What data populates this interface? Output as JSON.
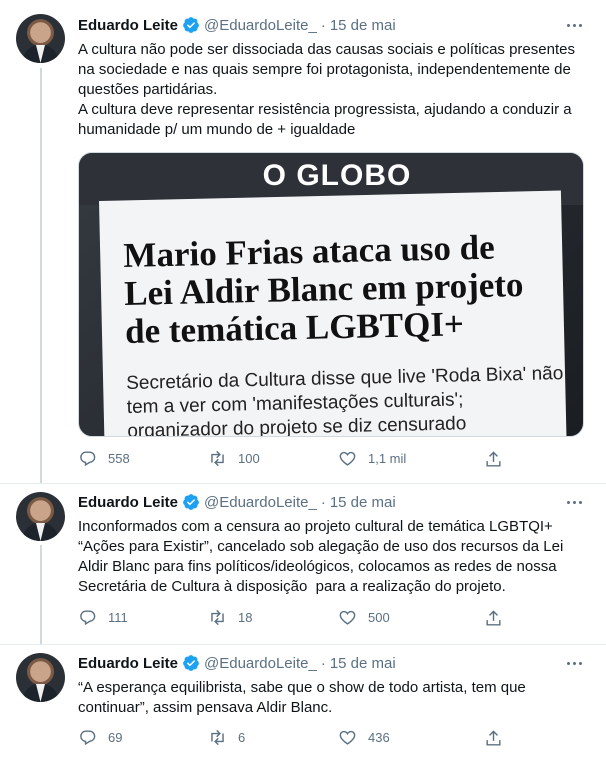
{
  "tweets": [
    {
      "name": "Eduardo Leite",
      "handle": "@EduardoLeite_",
      "dot": "·",
      "date": "15 de mai",
      "text": "A cultura não pode ser dissociada das causas sociais e políticas presentes na sociedade e nas quais sempre foi protagonista, independentemente de questões partidárias.\nA cultura deve representar resistência progressista, ajudando a conduzir a humanidade p/ um mundo de + igualdade",
      "media": {
        "masthead": "O GLOBO",
        "headline": "Mario Frias ataca uso de Lei Aldir Blanc em projeto de temática LGBTQI+",
        "subhead": "Secretário da Cultura disse que live 'Roda Bixa' não tem a ver com 'manifestações culturais'; organizador do projeto se diz censurado"
      },
      "replies": "558",
      "retweets": "100",
      "likes": "1,1 mil"
    },
    {
      "name": "Eduardo Leite",
      "handle": "@EduardoLeite_",
      "dot": "·",
      "date": "15 de mai",
      "text": "Inconformados com a censura ao projeto cultural de temática LGBTQI+ “Ações para Existir”, cancelado sob alegação de uso dos recursos da Lei Aldir Blanc para fins políticos/ideológicos, colocamos as redes de nossa Secretária de Cultura à disposição  para a realização do projeto.",
      "replies": "111",
      "retweets": "18",
      "likes": "500"
    },
    {
      "name": "Eduardo Leite",
      "handle": "@EduardoLeite_",
      "dot": "·",
      "date": "15 de mai",
      "text": "“A esperança equilibrista, sabe que o show de todo artista, tem que continuar”, assim pensava Aldir Blanc.",
      "replies": "69",
      "retweets": "6",
      "likes": "436"
    }
  ],
  "colors": {
    "text": "#0f1419",
    "secondary": "#5b7083",
    "verified": "#1da1f2",
    "divider": "#e6ecf0"
  },
  "icons": {
    "reply": "reply-icon",
    "retweet": "retweet-icon",
    "like": "heart-icon",
    "share": "share-icon",
    "verified": "verified-badge-icon",
    "more": "more-icon"
  }
}
